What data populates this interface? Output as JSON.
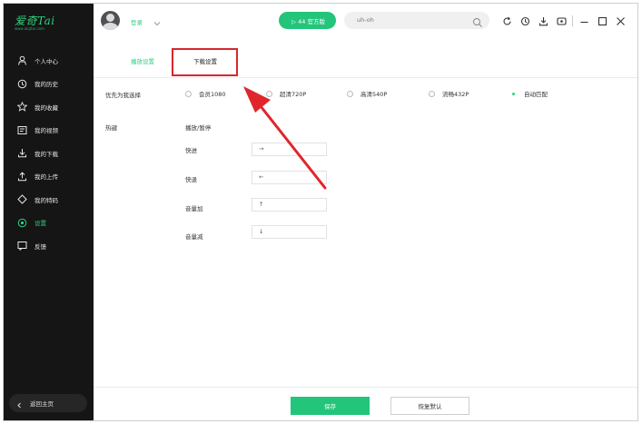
{
  "app": {
    "logo_text": "爱奇Tai",
    "logo_sub": "www.aiqitai.com"
  },
  "sidebar": {
    "items": [
      {
        "label": "个人中心",
        "icon": "person-icon"
      },
      {
        "label": "我的历史",
        "icon": "clock-icon"
      },
      {
        "label": "我的收藏",
        "icon": "star-icon"
      },
      {
        "label": "我的视频",
        "icon": "video-icon"
      },
      {
        "label": "我的下载",
        "icon": "download-icon"
      },
      {
        "label": "我的上传",
        "icon": "upload-icon"
      },
      {
        "label": "我的特码",
        "icon": "diamond-icon"
      },
      {
        "label": "设置",
        "icon": "settings-icon",
        "active": true
      },
      {
        "label": "反馈",
        "icon": "feedback-icon"
      }
    ],
    "back_label": "返回主页"
  },
  "topbar": {
    "login_label": "登录",
    "vip_label": "▷ 44 官方版",
    "search_value": "uh-oh"
  },
  "tabs": {
    "play": "播放设置",
    "download": "下载设置"
  },
  "settings": {
    "quality_label": "优先为我选择",
    "quality_options": [
      {
        "label": "会员1080",
        "selected": false
      },
      {
        "label": "超清720P",
        "selected": false
      },
      {
        "label": "高清540P",
        "selected": false
      },
      {
        "label": "流畅432P",
        "selected": false
      },
      {
        "label": "自动匹配",
        "selected": true
      }
    ],
    "hotkey_label": "热键",
    "hotkeys": [
      {
        "label": "播放/暂停",
        "value": ""
      },
      {
        "label": "快进",
        "value": "→"
      },
      {
        "label": "快退",
        "value": "←"
      },
      {
        "label": "音量加",
        "value": "↑"
      },
      {
        "label": "音量减",
        "value": "↓"
      }
    ]
  },
  "footer": {
    "save_label": "保存",
    "reset_label": "恢复默认"
  },
  "colors": {
    "accent": "#22c57a",
    "sidebar_bg": "#151515",
    "highlight": "#d5282c"
  }
}
